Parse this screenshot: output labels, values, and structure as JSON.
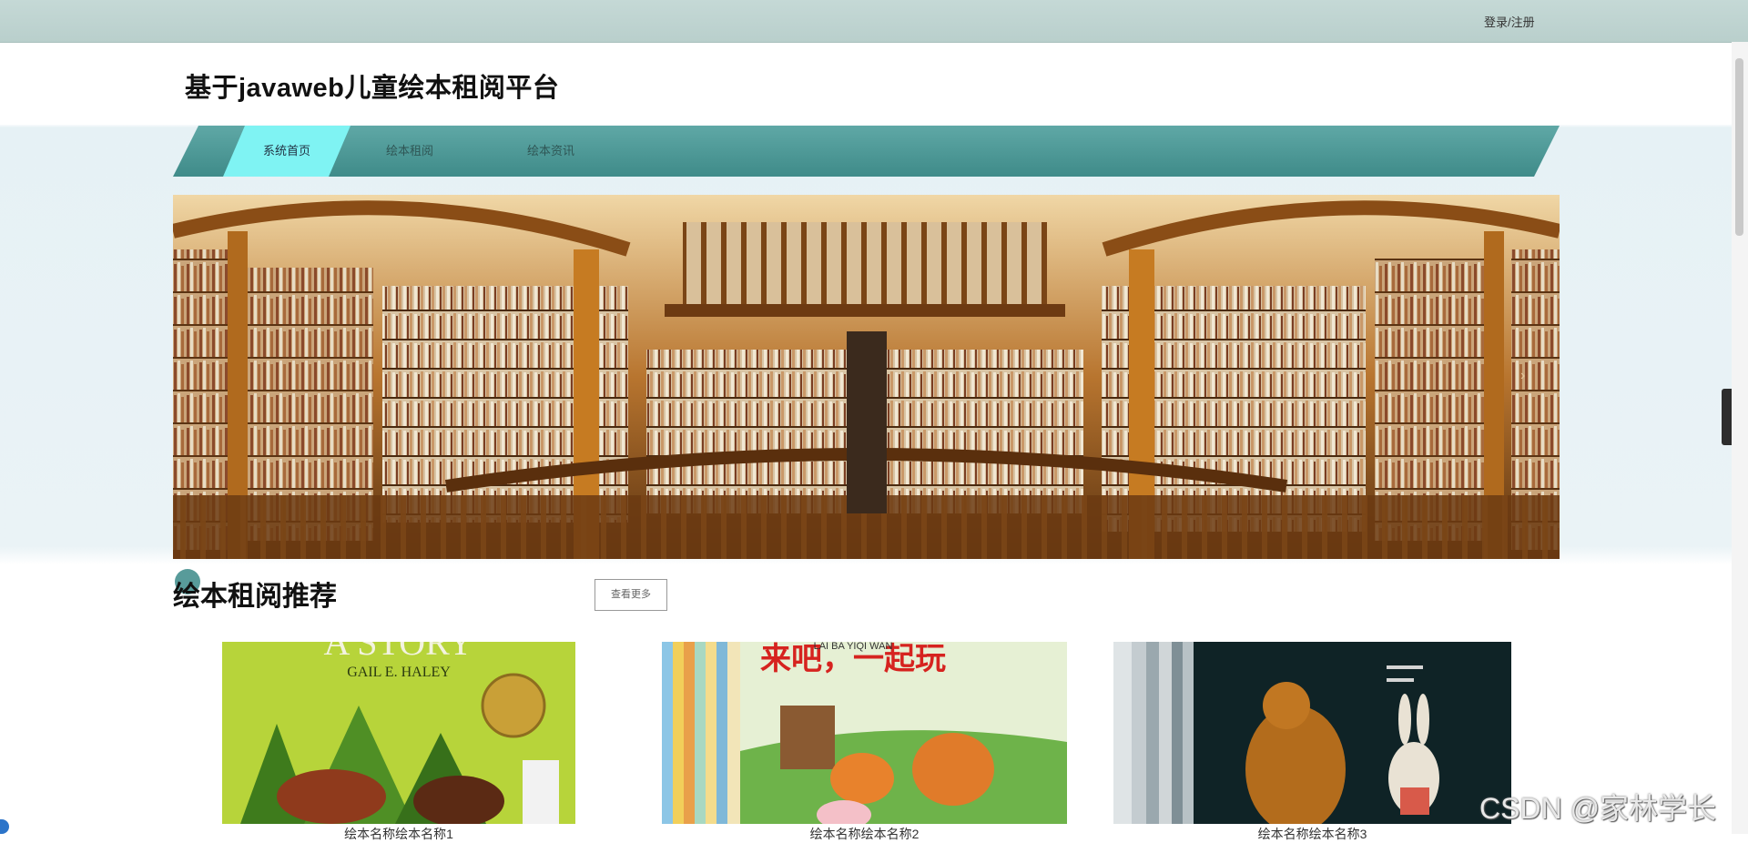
{
  "topbar": {
    "login_label": "登录/注册"
  },
  "header": {
    "site_title": "基于javaweb儿童绘本租阅平台"
  },
  "nav": {
    "items": [
      {
        "label": "系统首页",
        "active": true
      },
      {
        "label": "绘本租阅",
        "active": false
      },
      {
        "label": "绘本资讯",
        "active": false
      }
    ]
  },
  "banner": {
    "next_icon": "chevron-right-icon"
  },
  "recommend": {
    "title": "绘本租阅推荐",
    "more_label": "查看更多",
    "books": [
      {
        "cover_text": "A STORY",
        "cover_subtext": "GAIL E. HALEY",
        "name": "绘本名称绘本名称1"
      },
      {
        "cover_text": "来吧，一起玩",
        "cover_subtext": "LAI BA YIQI WAN",
        "name": "绘本名称绘本名称2"
      },
      {
        "cover_text": "",
        "cover_subtext": "",
        "name": "绘本名称绘本名称3"
      }
    ]
  },
  "side_toggle_icon": "chevron-left-icon",
  "watermark": "CSDN @家林学长",
  "colors": {
    "nav": "#4a9997",
    "nav_active": "#7ff3f3",
    "topbar": "#c5d9d6"
  }
}
